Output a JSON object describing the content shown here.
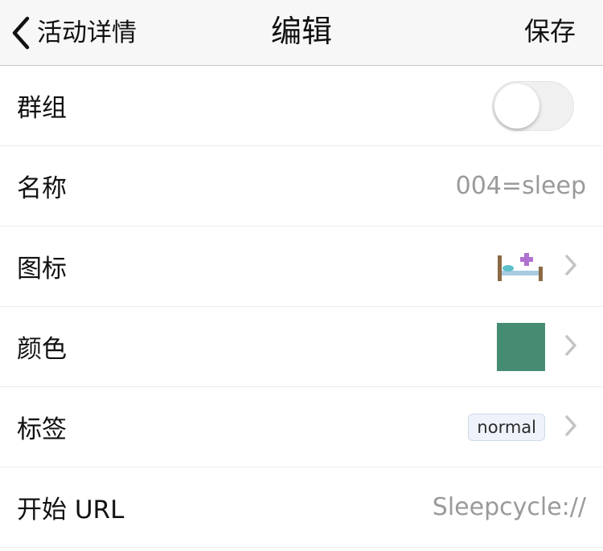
{
  "navbar": {
    "back_label": "活动详情",
    "title": "编辑",
    "save_label": "保存"
  },
  "rows": {
    "group": {
      "label": "群组",
      "toggle_on": false
    },
    "name": {
      "label": "名称",
      "value": "004=sleep"
    },
    "icon": {
      "label": "图标",
      "icon_name": "bed-icon"
    },
    "color": {
      "label": "颜色",
      "swatch_color": "#468c73"
    },
    "tags": {
      "label": "标签",
      "tag": "normal"
    },
    "start_url": {
      "label": "开始 URL",
      "value": "Sleepcycle://"
    }
  }
}
